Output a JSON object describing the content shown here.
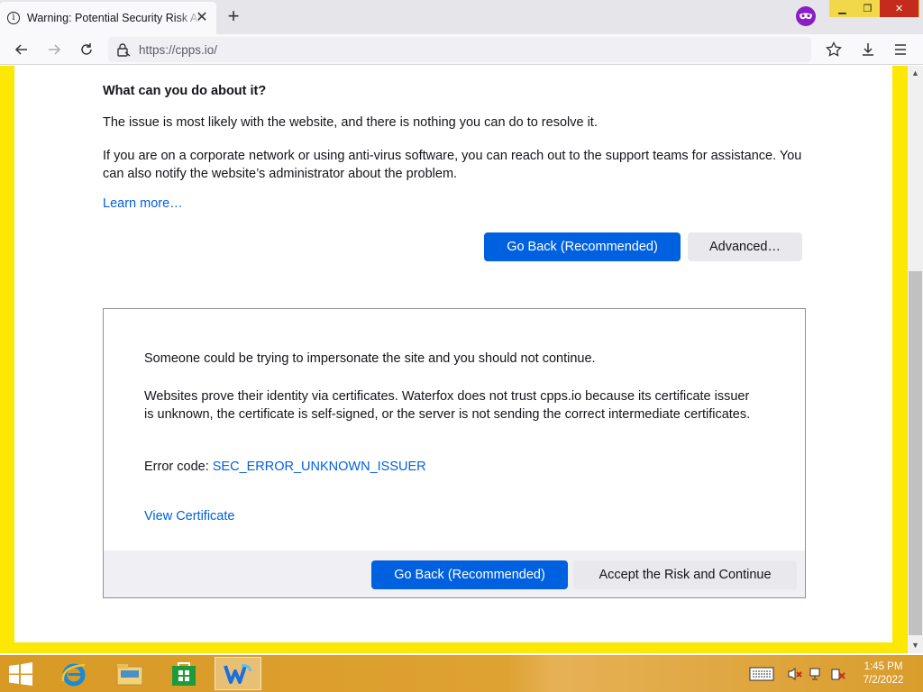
{
  "browser": {
    "tab": {
      "title": "Warning: Potential Security Risk Ahead",
      "close": "✕"
    },
    "new_tab": "+",
    "window_controls": {
      "minimize": "▁",
      "maximize": "❐",
      "close": "✕"
    },
    "url": "https://cpps.io/"
  },
  "page": {
    "heading": "What can you do about it?",
    "para1": "The issue is most likely with the website, and there is nothing you can do to resolve it.",
    "para2": "If you are on a corporate network or using anti-virus software, you can reach out to the support teams for assistance. You can also notify the website’s administrator about the problem.",
    "learn_more": "Learn more…",
    "go_back": "Go Back (Recommended)",
    "advanced": "Advanced…"
  },
  "advanced_panel": {
    "impersonate": "Someone could be trying to impersonate the site and you should not continue.",
    "certificate_text": "Websites prove their identity via certificates. Waterfox does not trust cpps.io because its certificate issuer is unknown, the certificate is self-signed, or the server is not sending the correct intermediate certificates.",
    "error_label": "Error code: ",
    "error_code": "SEC_ERROR_UNKNOWN_ISSUER",
    "view_certificate": "View Certificate",
    "go_back": "Go Back (Recommended)",
    "accept": "Accept the Risk and Continue"
  },
  "taskbar": {
    "time": "1:45 PM",
    "date": "7/2/2022"
  },
  "colors": {
    "accent": "#0061e0",
    "frame": "#fde705",
    "taskbar": "#d89a25"
  }
}
